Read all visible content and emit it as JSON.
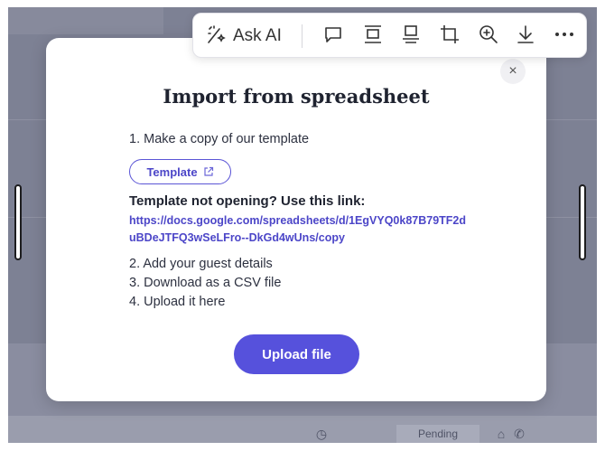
{
  "background": {
    "status_pill": "Pending"
  },
  "toolbar": {
    "ask_ai_label": "Ask AI",
    "icons": [
      "ai-magic-icon",
      "comment-icon",
      "align-top-icon",
      "align-bottom-icon",
      "crop-icon",
      "zoom-in-icon",
      "download-icon",
      "more-icon"
    ]
  },
  "modal": {
    "title": "Import from spreadsheet",
    "step1": "1. Make a copy of our template",
    "template_button": "Template",
    "fallback_heading": "Template not opening? Use this link:",
    "fallback_link": "https://docs.google.com/spreadsheets/d/1EgVYQ0k87B79TF2duBDeJTFQ3wSeLFro--DkGd4wUns/copy",
    "step2": "2. Add your guest details",
    "step3": "3. Download as a CSV file",
    "step4": "4. Upload it here",
    "upload_button": "Upload file",
    "close_symbol": "×"
  },
  "colors": {
    "accent": "#5651dc",
    "link": "#4c46c8",
    "overlay": "#7d8194"
  }
}
